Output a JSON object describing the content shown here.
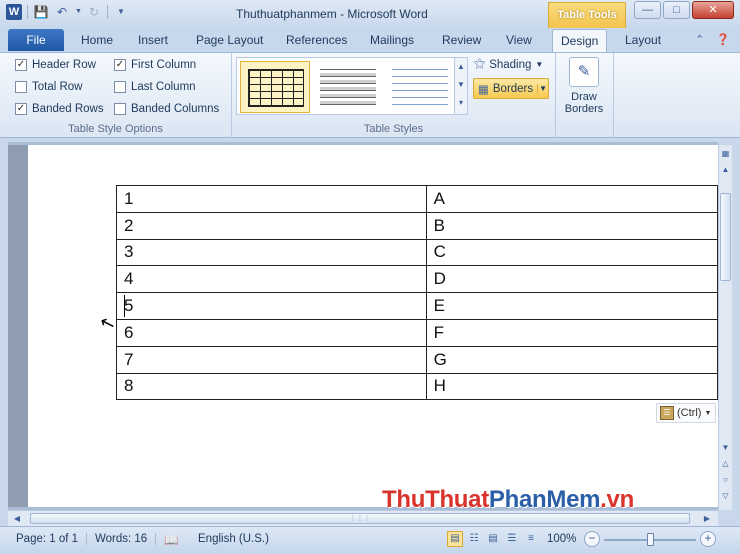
{
  "window": {
    "title": "Thuthuatphanmem  -  Microsoft Word",
    "contextual_tab": "Table Tools",
    "app_icon_letter": "W"
  },
  "ribbon_tabs": {
    "file": "File",
    "items": [
      "Home",
      "Insert",
      "Page Layout",
      "References",
      "Mailings",
      "Review",
      "View",
      "Design",
      "Layout"
    ],
    "active": "Design"
  },
  "table_style_options": {
    "label": "Table Style Options",
    "items": [
      {
        "label": "Header Row",
        "checked": true
      },
      {
        "label": "First Column",
        "checked": true
      },
      {
        "label": "Total Row",
        "checked": false
      },
      {
        "label": "Last Column",
        "checked": false
      },
      {
        "label": "Banded Rows",
        "checked": true
      },
      {
        "label": "Banded Columns",
        "checked": false
      }
    ]
  },
  "table_styles": {
    "label": "Table Styles",
    "shading_label": "Shading",
    "borders_label": "Borders"
  },
  "draw_borders": {
    "line1": "Draw",
    "line2": "Borders"
  },
  "document": {
    "table": [
      [
        "1",
        "A"
      ],
      [
        "2",
        "B"
      ],
      [
        "3",
        "C"
      ],
      [
        "4",
        "D"
      ],
      [
        "5",
        "E"
      ],
      [
        "6",
        "F"
      ],
      [
        "7",
        "G"
      ],
      [
        "8",
        "H"
      ]
    ],
    "paste_options_label": "(Ctrl)"
  },
  "watermark": {
    "part1": "ThuThuat",
    "part2": "PhanMem",
    "part3": ".vn"
  },
  "statusbar": {
    "page": "Page: 1 of 1",
    "words": "Words: 16",
    "language": "English (U.S.)",
    "zoom": "100%",
    "zoom_fraction": 0.5
  }
}
